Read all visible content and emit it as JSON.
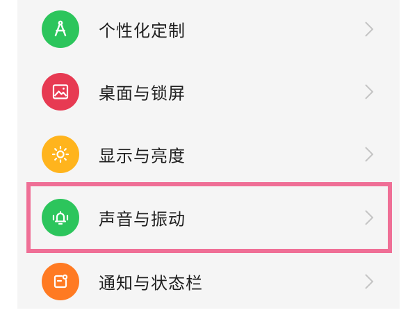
{
  "settings": {
    "items": [
      {
        "label": "个性化定制",
        "icon": "compass-icon",
        "color": "#2cc55c"
      },
      {
        "label": "桌面与锁屏",
        "icon": "image-icon",
        "color": "#e73a52"
      },
      {
        "label": "显示与亮度",
        "icon": "sun-icon",
        "color": "#ffb41d"
      },
      {
        "label": "声音与振动",
        "icon": "bell-icon",
        "color": "#2cc55c"
      },
      {
        "label": "通知与状态栏",
        "icon": "notification-icon",
        "color": "#ff7a22"
      }
    ]
  },
  "highlight": {
    "color": "#ef6f96",
    "target": "声音与振动"
  }
}
